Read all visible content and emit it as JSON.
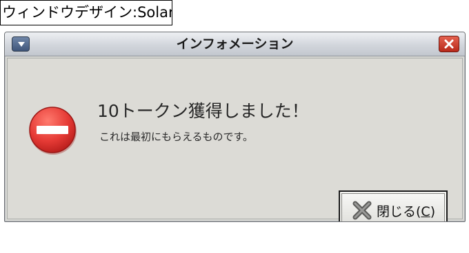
{
  "caption": "ウィンドウデザイン:Solaris",
  "dialog": {
    "title": "インフォメーション",
    "heading": "10トークン獲得しました！",
    "message": "これは最初にもらえるものです。",
    "close_button": {
      "label_prefix": "閉じる(",
      "mnemonic": "C",
      "label_suffix": ")",
      "icon": "x-icon"
    },
    "icon": "stop-icon"
  },
  "colors": {
    "stop_red": "#e53a35",
    "close_red": "#c8321f",
    "menu_blue": "#4e6690"
  }
}
